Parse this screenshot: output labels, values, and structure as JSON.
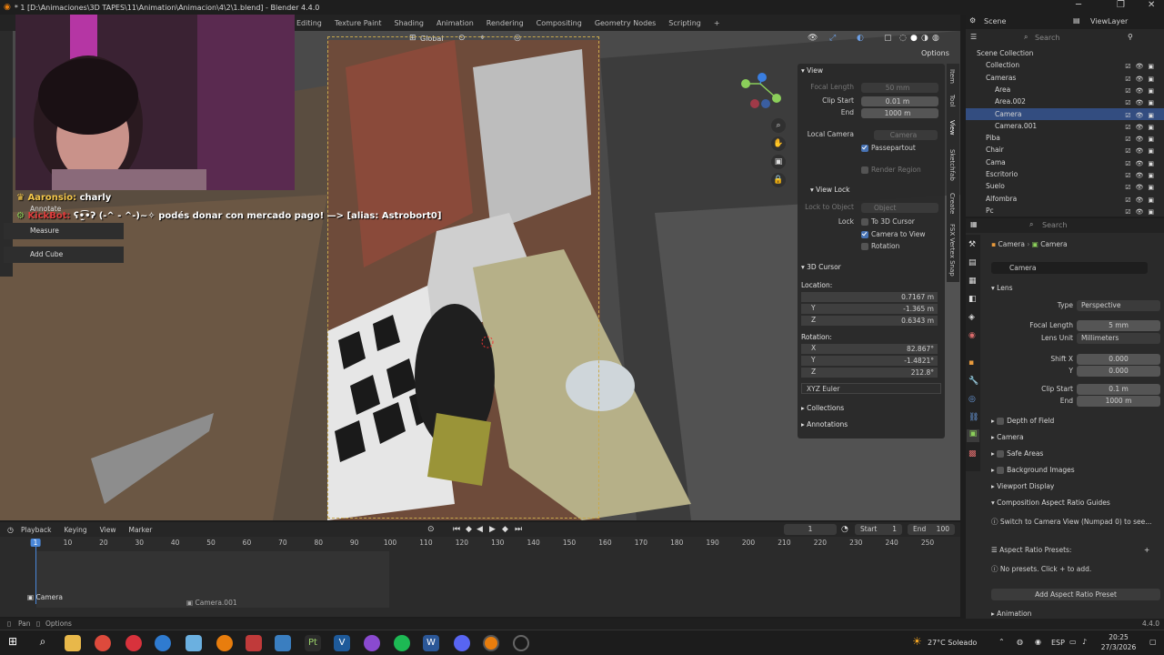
{
  "window": {
    "title": "* 1 [D:\\Animaciones\\3D TAPES\\11\\Animation\\Animacion\\4\\2\\1.blend] - Blender 4.4.0",
    "minimize": "─",
    "maximize": "❐",
    "close": "✕"
  },
  "workspaces": [
    "Editing",
    "Texture Paint",
    "Shading",
    "Animation",
    "Rendering",
    "Compositing",
    "Geometry Nodes",
    "Scripting",
    "+"
  ],
  "viewport_header": {
    "transform_orientation": "Global",
    "options_label": "Options"
  },
  "overlay_chat": {
    "line1_user": "Aaronsio:",
    "line1_msg": "charly",
    "line2_user": "KickBot:",
    "line2_msg": "ʕ•̫͡•ʔ (-^ - ^-)~✧ podés donar con mercado pago! —> [alias: Astrobort0]"
  },
  "tool_menu": [
    "Annotate",
    "Measure",
    "Add Cube"
  ],
  "npanel": {
    "tabs": [
      "Item",
      "Tool",
      "View",
      "Sketchfab",
      "Create",
      "FSX Vertex Snap"
    ],
    "view_section": "View",
    "focal_length_label": "Focal Length",
    "focal_length_value": "50 mm",
    "clip_start_label": "Clip Start",
    "clip_start_value": "0.01 m",
    "end_label": "End",
    "end_value": "1000 m",
    "local_camera_label": "Local Camera",
    "local_camera_value": "Camera",
    "passepartout_label": "Passepartout",
    "render_region_label": "Render Region",
    "view_lock_section": "View Lock",
    "lock_to_object_label": "Lock to Object",
    "lock_to_object_placeholder": "Object",
    "lock_label": "Lock",
    "to_3d_cursor_label": "To 3D Cursor",
    "camera_to_view_label": "Camera to View",
    "rotation_label": "Rotation",
    "cursor_section": "3D Cursor",
    "location_label": "Location:",
    "loc_x": "0.7167 m",
    "loc_y": "-1.365 m",
    "loc_z": "0.6343 m",
    "rotation_heading": "Rotation:",
    "rot_x": "82.867°",
    "rot_y": "-1.4821°",
    "rot_z": "212.8°",
    "rotation_mode": "XYZ Euler",
    "collections_section": "Collections",
    "annotations_section": "Annotations",
    "axis_x": "X",
    "axis_y": "Y",
    "axis_z": "Z"
  },
  "outliner": {
    "scene_label": "Scene",
    "view_layer_label": "ViewLayer",
    "search_placeholder": "Search",
    "rows": [
      {
        "name": "Scene Collection",
        "indent": 0,
        "selected": false
      },
      {
        "name": "Collection",
        "indent": 1,
        "selected": false
      },
      {
        "name": "Cameras",
        "indent": 1,
        "selected": false
      },
      {
        "name": "Area",
        "indent": 2,
        "selected": false
      },
      {
        "name": "Area.002",
        "indent": 2,
        "selected": false
      },
      {
        "name": "Camera",
        "indent": 2,
        "selected": true
      },
      {
        "name": "Camera.001",
        "indent": 2,
        "selected": false
      },
      {
        "name": "Piba",
        "indent": 1,
        "selected": false
      },
      {
        "name": "Chair",
        "indent": 1,
        "selected": false
      },
      {
        "name": "Cama",
        "indent": 1,
        "selected": false
      },
      {
        "name": "Escritorio",
        "indent": 1,
        "selected": false
      },
      {
        "name": "Suelo",
        "indent": 1,
        "selected": false
      },
      {
        "name": "Alfombra",
        "indent": 1,
        "selected": false
      },
      {
        "name": "Pc",
        "indent": 1,
        "selected": false
      }
    ]
  },
  "properties": {
    "search_placeholder": "Search",
    "breadcrumb_object": "Camera",
    "breadcrumb_data": "Camera",
    "datablock": "Camera",
    "lens_section": "Lens",
    "type_label": "Type",
    "type_value": "Perspective",
    "focal_length_label": "Focal Length",
    "focal_length_value": "5 mm",
    "lens_unit_label": "Lens Unit",
    "lens_unit_value": "Millimeters",
    "shift_x_label": "Shift X",
    "shift_x_value": "0.000",
    "shift_y_label": "Y",
    "shift_y_value": "0.000",
    "clip_start_label": "Clip Start",
    "clip_start_value": "0.1 m",
    "clip_end_label": "End",
    "clip_end_value": "1000 m",
    "sections": [
      "Depth of Field",
      "Camera",
      "Safe Areas",
      "Background Images",
      "Viewport Display",
      "Composition Aspect Ratio Guides"
    ],
    "switch_hint": "Switch to Camera View (Numpad 0) to see...",
    "aspect_presets_label": "Aspect Ratio Presets:",
    "no_presets": "No presets. Click + to add.",
    "add_preset_button": "Add Aspect Ratio Preset",
    "animation_section": "Animation",
    "version": "4.4.0"
  },
  "timeline": {
    "menus": [
      "Playback",
      "Keying",
      "View",
      "Marker"
    ],
    "current_frame": "1",
    "start_label": "Start",
    "start_value": "1",
    "end_label": "End",
    "end_value": "100",
    "ticks": [
      "1",
      "10",
      "20",
      "30",
      "40",
      "50",
      "60",
      "70",
      "80",
      "90",
      "100",
      "110",
      "120",
      "130",
      "140",
      "150",
      "160",
      "170",
      "180",
      "190",
      "200",
      "210",
      "220",
      "230",
      "240",
      "250"
    ],
    "marker1": "Camera",
    "marker2": "Camera.001"
  },
  "statusbar": {
    "pan": "Pan",
    "options": "Options"
  },
  "taskbar": {
    "weather": "27°C  Soleado",
    "lang": "ESP",
    "time": "20:25",
    "date": "27/3/2026"
  },
  "colors": {
    "accent": "#4772b3",
    "selection": "#334d80",
    "camera_frame": "#c9a94d",
    "playhead": "#4a87d8",
    "chat_user": "#f5c84b",
    "bot_user": "#e03c3c"
  }
}
